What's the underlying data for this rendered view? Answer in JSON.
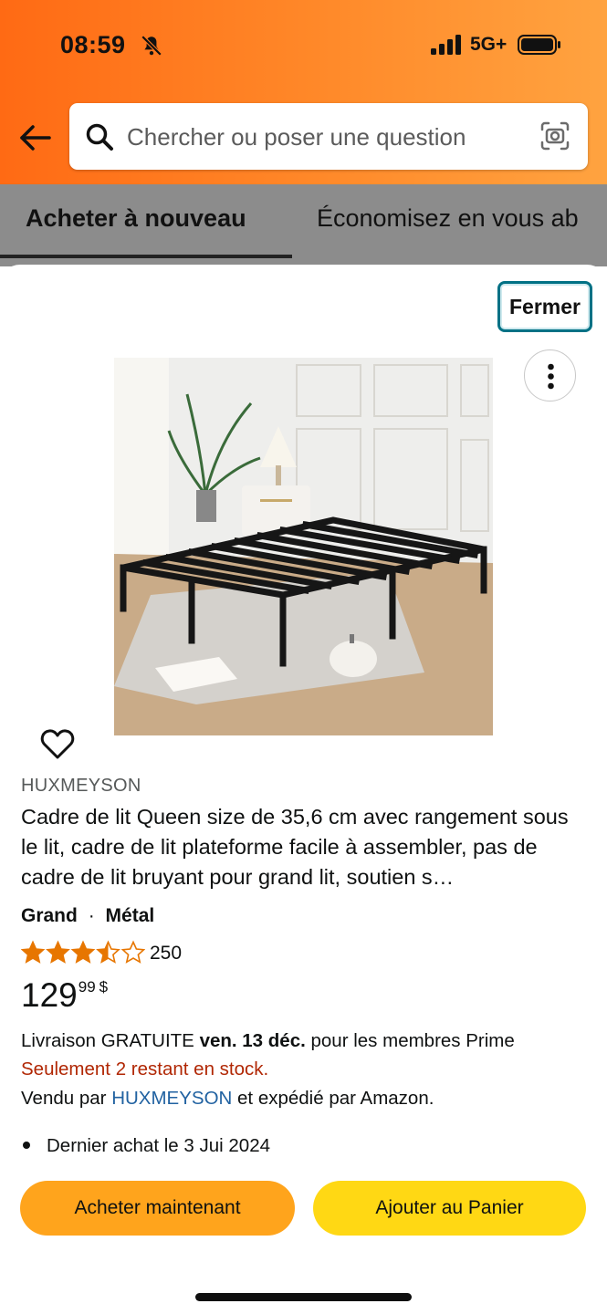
{
  "status_bar": {
    "time": "08:59",
    "network": "5G+",
    "bell_icon": "bell-slash-icon",
    "signal_icon": "signal-bars-icon",
    "battery_icon": "battery-icon"
  },
  "search": {
    "placeholder": "Chercher ou poser une question",
    "back_icon": "arrow-left-icon",
    "search_icon": "magnifier-icon",
    "camera_icon": "camera-lens-icon"
  },
  "tabs": [
    {
      "label": "Acheter à nouveau",
      "active": true
    },
    {
      "label": "Économisez en vous ab",
      "active": false
    }
  ],
  "modal": {
    "close_label": "Fermer",
    "more_icon": "vertical-ellipsis-icon",
    "heart_icon": "heart-outline-icon",
    "product": {
      "brand": "HUXMEYSON",
      "title": "Cadre de lit Queen size de 35,6 cm avec rangement sous le lit, cadre de lit plateforme facile à assembler, pas de cadre de lit bruyant pour grand lit, soutien s…",
      "size": "Grand",
      "separator": "·",
      "material": "Métal",
      "rating": 3.5,
      "rating_max": 5,
      "rating_count": "250",
      "price_whole": "129",
      "price_cents": "99",
      "currency": "$",
      "delivery_prefix": "Livraison GRATUITE",
      "delivery_date": "ven. 13 déc.",
      "delivery_suffix": "pour les membres Prime",
      "stock": "Seulement 2 restant en stock.",
      "sold_by_prefix": "Vendu par",
      "seller": "HUXMEYSON",
      "sold_by_suffix": "et expédié par Amazon.",
      "last_purchase": "Dernier achat le 3 Jui 2024"
    },
    "buttons": {
      "buy_now": "Acheter maintenant",
      "add_to_cart": "Ajouter au Panier"
    }
  },
  "colors": {
    "header_orange": "#ff7a1f",
    "accent_teal": "#007185",
    "buy_now": "#ffa41c",
    "add_to_cart": "#ffd814",
    "stock_red": "#b12704",
    "link_blue": "#2162a1",
    "star": "#e77600"
  }
}
